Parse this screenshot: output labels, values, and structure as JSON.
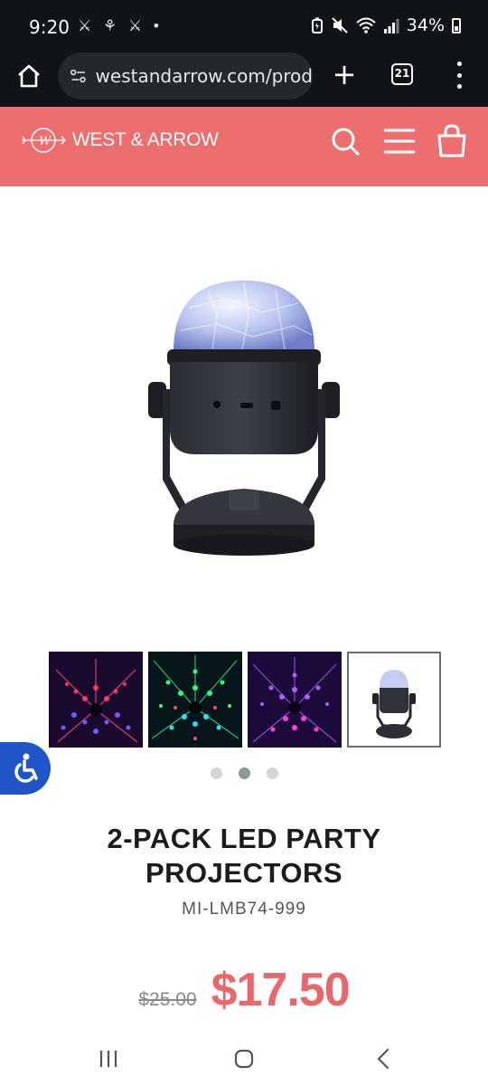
{
  "status_bar": {
    "time": "9:20",
    "notification_icons": "⚔ ⚘ ⚔ •",
    "battery": "34%"
  },
  "browser": {
    "url": "westandarrow.com/prod",
    "tab_count": "21"
  },
  "header": {
    "brand": "WEST & ARROW",
    "background": "#ec6e6e"
  },
  "product": {
    "title": "2-PACK LED PARTY PROJECTORS",
    "sku": "MI-LMB74-999",
    "original_price": "$25.00",
    "sale_price": "$17.50",
    "price_color": "#e8676b"
  },
  "gallery": {
    "thumbnails": [
      "red-blue-light-pattern",
      "green-light-pattern",
      "purple-light-pattern",
      "projector-product"
    ],
    "active_thumbnail": 4,
    "dots": 3,
    "active_dot": 2
  },
  "accessibility": {
    "accent": "#1f55c7"
  }
}
